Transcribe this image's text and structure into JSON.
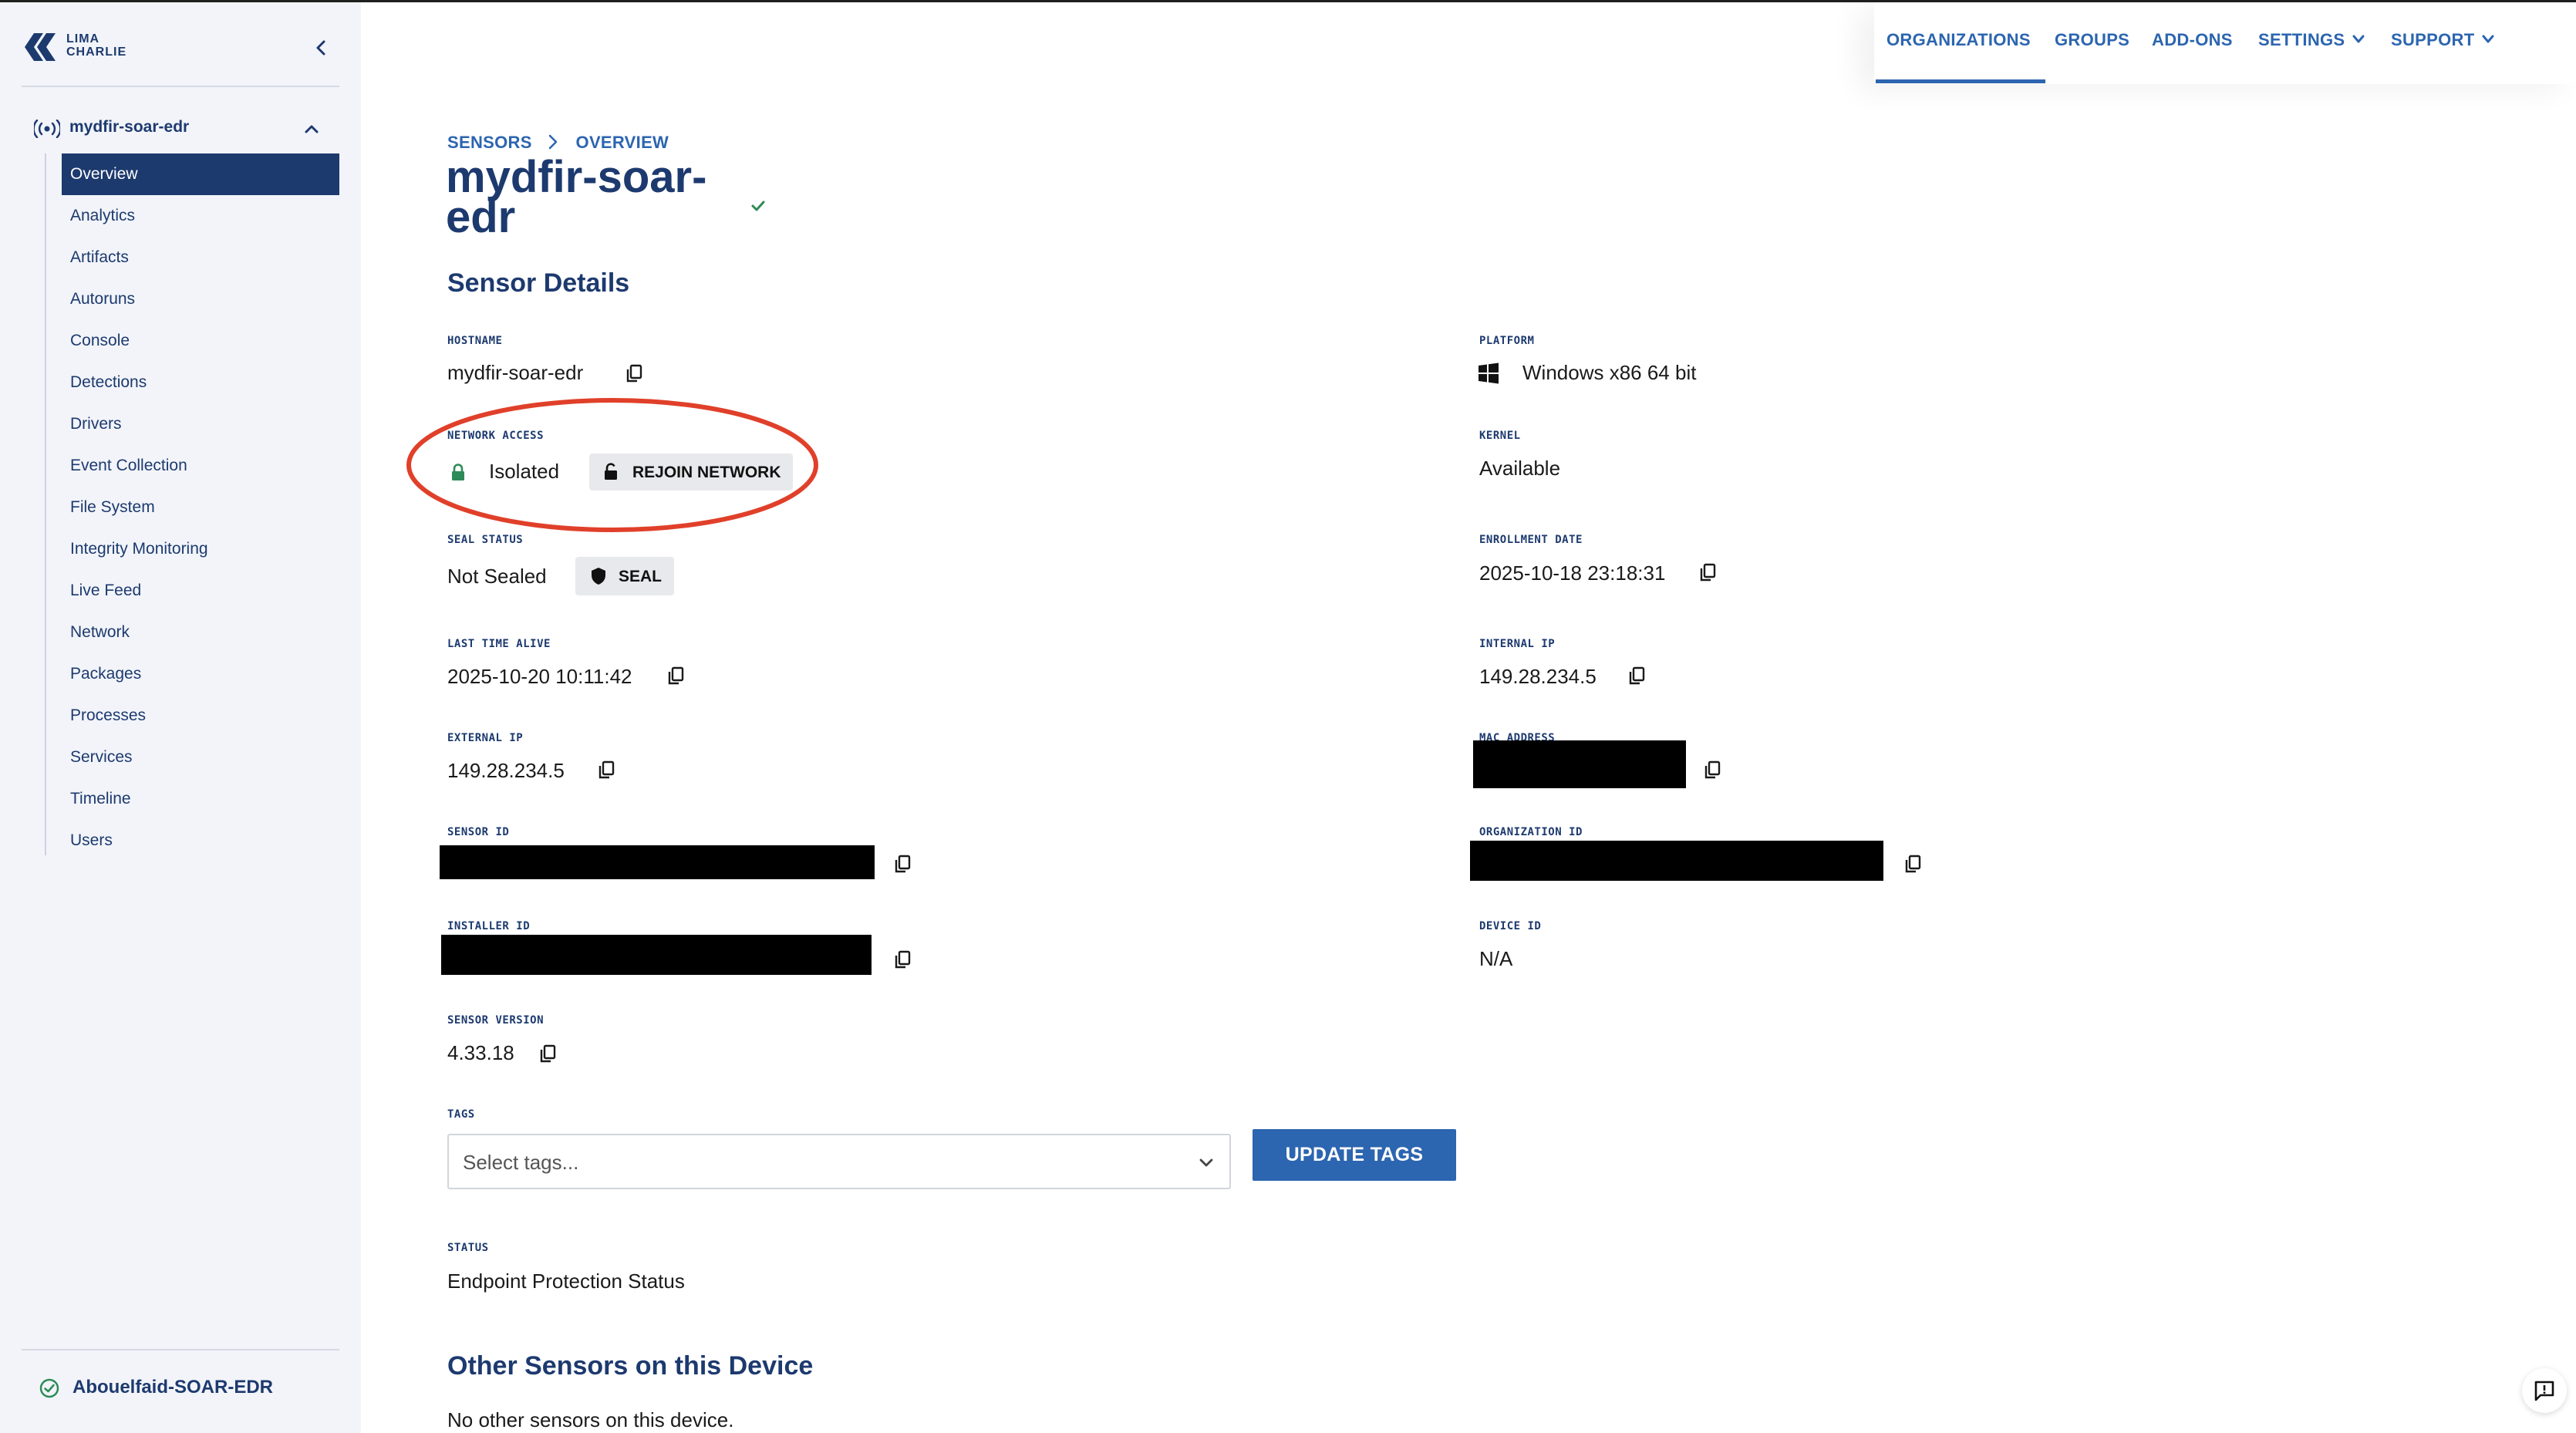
{
  "logo": {
    "line1": "LIMA",
    "line2": "CHARLIE"
  },
  "sidebar": {
    "org_name": "mydfir-soar-edr",
    "items": [
      {
        "label": "Overview",
        "active": true
      },
      {
        "label": "Analytics"
      },
      {
        "label": "Artifacts"
      },
      {
        "label": "Autoruns"
      },
      {
        "label": "Console"
      },
      {
        "label": "Detections"
      },
      {
        "label": "Drivers"
      },
      {
        "label": "Event Collection"
      },
      {
        "label": "File System"
      },
      {
        "label": "Integrity Monitoring"
      },
      {
        "label": "Live Feed"
      },
      {
        "label": "Network"
      },
      {
        "label": "Packages"
      },
      {
        "label": "Processes"
      },
      {
        "label": "Services"
      },
      {
        "label": "Timeline"
      },
      {
        "label": "Users"
      }
    ],
    "footer_org": "Abouelfaid-SOAR-EDR"
  },
  "topnav": {
    "organizations": "ORGANIZATIONS",
    "groups": "GROUPS",
    "addons": "ADD-ONS",
    "settings": "SETTINGS",
    "support": "SUPPORT"
  },
  "breadcrumb": {
    "root": "SENSORS",
    "current": "OVERVIEW"
  },
  "page": {
    "title_line1": "mydfir-soar-",
    "title_line2": "edr",
    "section_title": "Sensor Details",
    "other_sensors_title": "Other Sensors on this Device",
    "other_sensors_text": "No other sensors on this device."
  },
  "fields": {
    "hostname": {
      "label": "HOSTNAME",
      "value": "mydfir-soar-edr"
    },
    "platform": {
      "label": "PLATFORM",
      "value": "Windows x86 64 bit"
    },
    "network_access": {
      "label": "NETWORK ACCESS",
      "value": "Isolated",
      "button": "REJOIN NETWORK"
    },
    "kernel": {
      "label": "KERNEL",
      "value": "Available"
    },
    "seal_status": {
      "label": "SEAL STATUS",
      "value": "Not Sealed",
      "button": "SEAL"
    },
    "enrollment_date": {
      "label": "ENROLLMENT DATE",
      "value": "2025-10-18 23:18:31"
    },
    "last_time_alive": {
      "label": "LAST TIME ALIVE",
      "value": "2025-10-20 10:11:42"
    },
    "internal_ip": {
      "label": "INTERNAL IP",
      "value": "149.28.234.5"
    },
    "external_ip": {
      "label": "EXTERNAL IP",
      "value": "149.28.234.5"
    },
    "mac_address": {
      "label": "MAC ADDRESS"
    },
    "sensor_id": {
      "label": "SENSOR ID"
    },
    "organization_id": {
      "label": "ORGANIZATION ID"
    },
    "installer_id": {
      "label": "INSTALLER ID"
    },
    "device_id": {
      "label": "DEVICE ID",
      "value": "N/A"
    },
    "sensor_version": {
      "label": "SENSOR VERSION",
      "value": "4.33.18"
    },
    "tags": {
      "label": "TAGS",
      "placeholder": "Select tags...",
      "button": "UPDATE TAGS"
    },
    "status": {
      "label": "STATUS",
      "value": "Endpoint Protection Status"
    }
  },
  "colors": {
    "brand": "#1d3a6f",
    "accent": "#2c65b0",
    "highlight": "#e0402a",
    "success": "#2e8b57"
  }
}
